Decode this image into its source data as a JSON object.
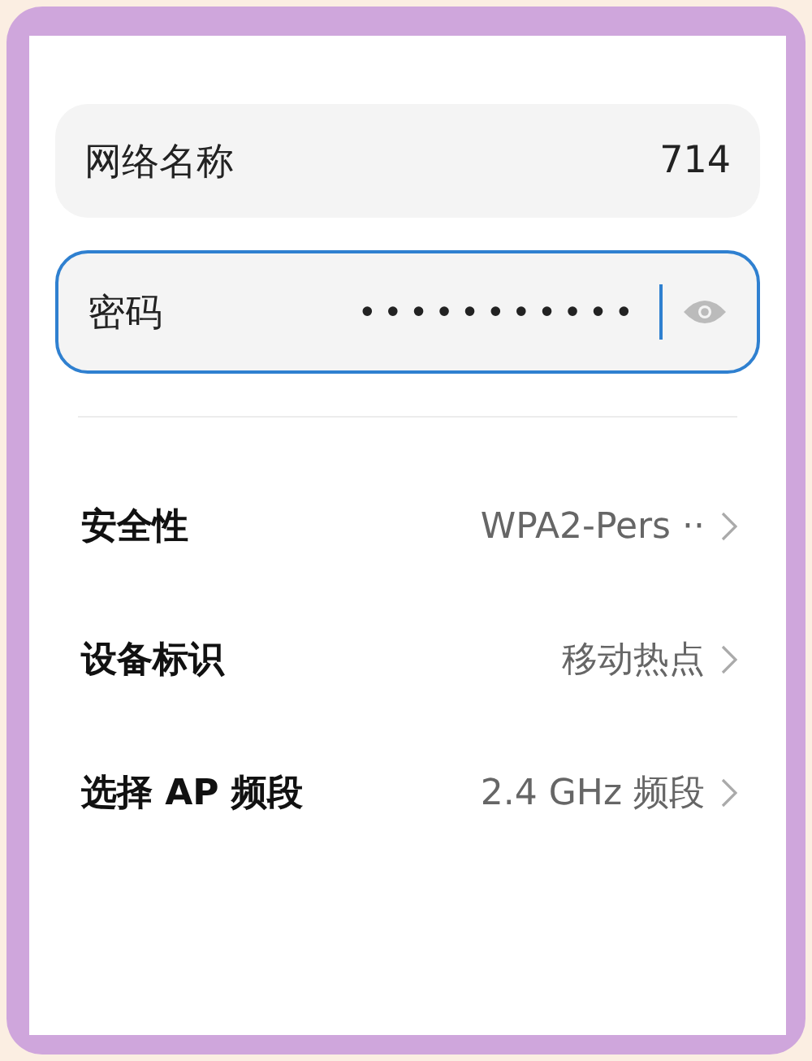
{
  "fields": [
    {
      "kind": "text",
      "label": "网络名称",
      "value": "714",
      "focused": false
    },
    {
      "kind": "password",
      "label": "密码",
      "value": "•••••••••••",
      "focused": true
    }
  ],
  "settings": [
    {
      "label": "安全性",
      "value": "WPA2-Pers ··"
    },
    {
      "label": "设备标识",
      "value": "移动热点"
    },
    {
      "label": "选择 AP 频段",
      "value": "2.4 GHz 频段"
    }
  ]
}
